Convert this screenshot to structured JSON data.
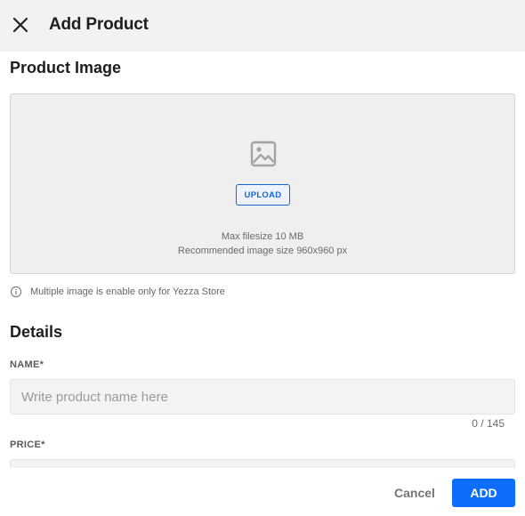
{
  "header": {
    "title": "Add Product",
    "close_icon": "close-icon"
  },
  "product_image": {
    "section_title": "Product Image",
    "icon": "image-icon",
    "upload_label": "UPLOAD",
    "max_filesize": "Max filesize 10 MB",
    "recommended_size": "Recommended image size 960x960 px",
    "info_icon": "info-icon",
    "info_text": "Multiple image is enable only for Yezza Store"
  },
  "details": {
    "section_title": "Details",
    "name": {
      "label": "NAME*",
      "value": "",
      "placeholder": "Write product name here",
      "char_count": "0 / 145"
    },
    "price": {
      "label": "PRICE*",
      "value": ""
    }
  },
  "footer": {
    "cancel_label": "Cancel",
    "add_label": "ADD"
  },
  "colors": {
    "accent": "#0d6efd",
    "header_bg": "#f1f2f4",
    "upload_border": "#1766d4"
  }
}
